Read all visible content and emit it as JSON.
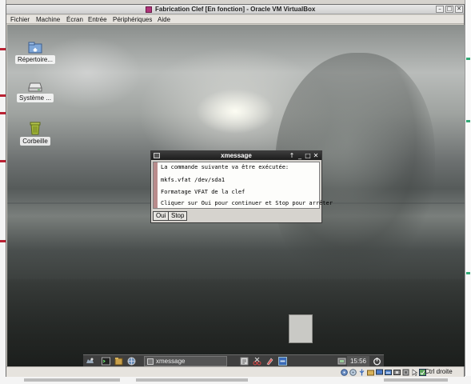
{
  "window": {
    "title": "Fabrication Clef [En fonction] - Oracle VM VirtualBox"
  },
  "window_controls": {
    "minimize": "–",
    "maximize": "□",
    "close": "✕"
  },
  "menubar": {
    "items": [
      "Fichier",
      "Machine",
      "Écran",
      "Entrée",
      "Périphériques",
      "Aide"
    ]
  },
  "desktop": {
    "icons": [
      {
        "label": "Répertoire...",
        "icon": "home-folder-icon"
      },
      {
        "label": "Système ...",
        "icon": "drive-icon"
      },
      {
        "label": "Corbeille",
        "icon": "trash-icon"
      }
    ]
  },
  "xmessage": {
    "title": "xmessage",
    "titlebar_buttons": {
      "up": "↑",
      "minimize": "_",
      "maximize": "□",
      "close": "✕"
    },
    "lines": [
      "La commande suivante va être exécutée:",
      "mkfs.vfat /dev/sda1",
      "Formatage VFAT de la clef",
      "Cliquer sur Oui pour continuer et Stop pour arrêter"
    ],
    "buttons": {
      "yes": "Oui",
      "stop": "Stop"
    }
  },
  "taskbar": {
    "task": "xmessage",
    "clock": "15:56"
  },
  "statusbar": {
    "host_key": "Ctrl droite"
  },
  "colors": {
    "dialog_scrollbar": "#b98b8b",
    "taskbar": "#3f3f3f",
    "accent": "#b0347a"
  }
}
